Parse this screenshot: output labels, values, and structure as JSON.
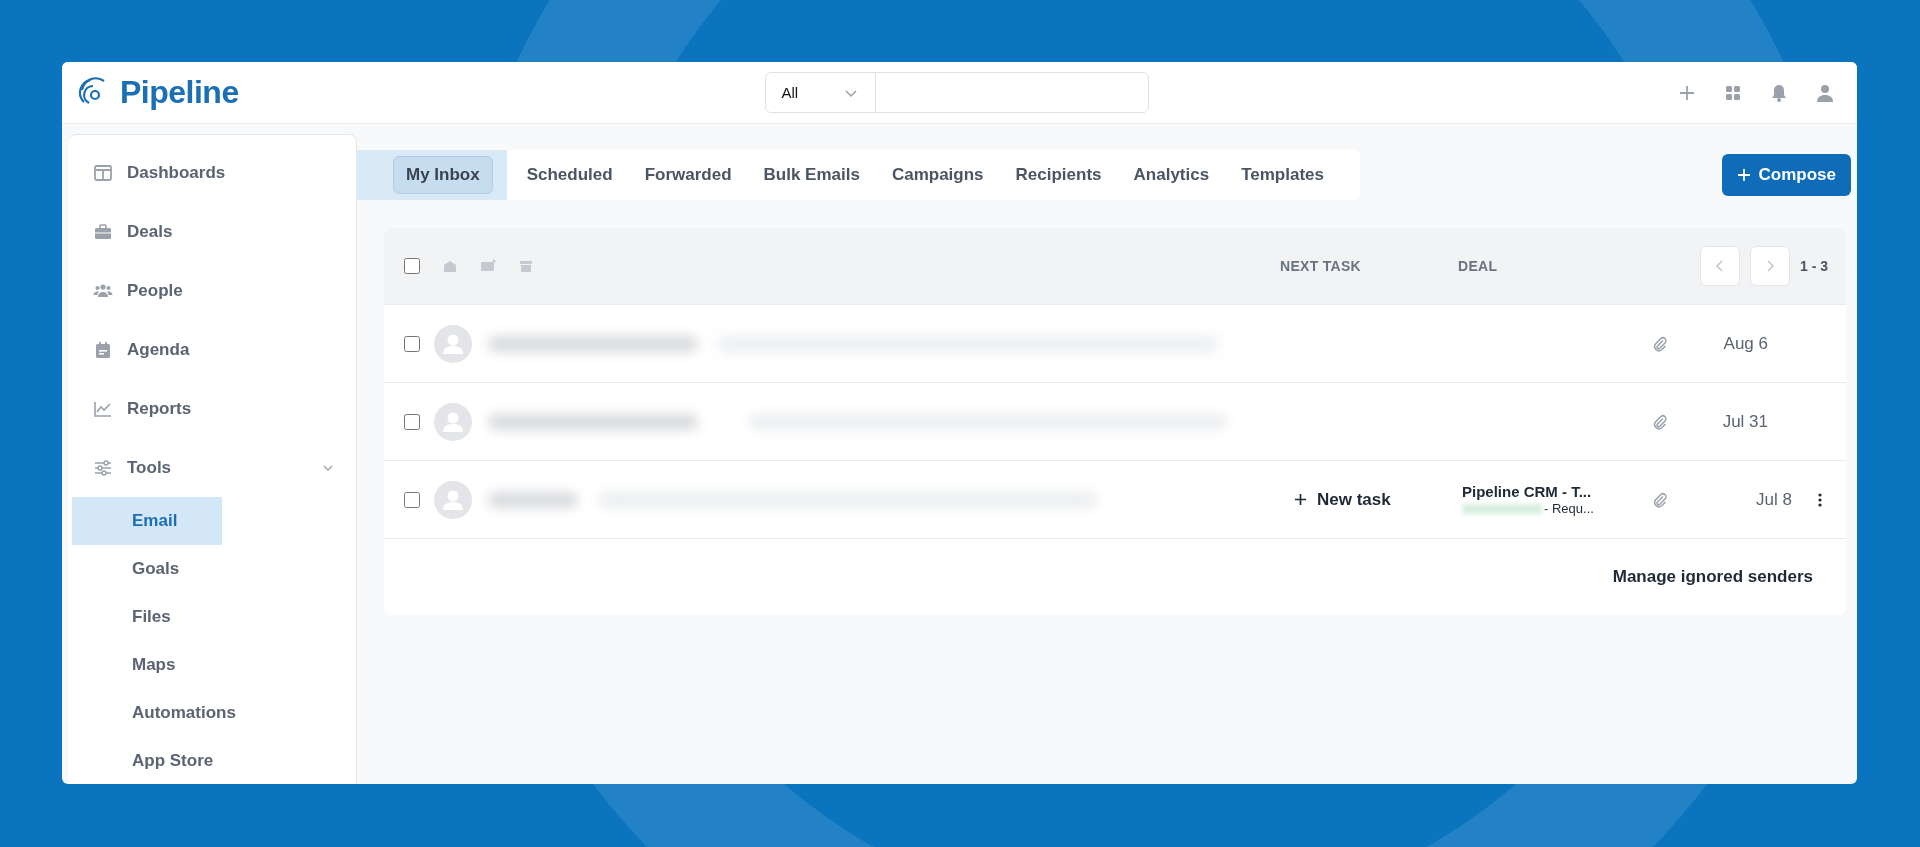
{
  "header": {
    "logo": "Pipeline",
    "search_scope": "All"
  },
  "sidebar": {
    "items": [
      {
        "label": "Dashboards",
        "selected": false
      },
      {
        "label": "Deals",
        "selected": false
      },
      {
        "label": "People",
        "selected": false
      },
      {
        "label": "Agenda",
        "selected": false
      },
      {
        "label": "Reports",
        "selected": false
      },
      {
        "label": "Tools",
        "selected": false,
        "expanded": true,
        "children": [
          {
            "label": "Email",
            "selected": true
          },
          {
            "label": "Goals",
            "selected": false
          },
          {
            "label": "Files",
            "selected": false
          },
          {
            "label": "Maps",
            "selected": false
          },
          {
            "label": "Automations",
            "selected": false
          },
          {
            "label": "App Store",
            "selected": false
          }
        ]
      }
    ]
  },
  "tabs": [
    {
      "label": "My Inbox",
      "selected": true
    },
    {
      "label": "Scheduled",
      "selected": false
    },
    {
      "label": "Forwarded",
      "selected": false
    },
    {
      "label": "Bulk Emails",
      "selected": false
    },
    {
      "label": "Campaigns",
      "selected": false
    },
    {
      "label": "Recipients",
      "selected": false
    },
    {
      "label": "Analytics",
      "selected": false
    },
    {
      "label": "Templates",
      "selected": false
    }
  ],
  "compose": "Compose",
  "table": {
    "select_all_checked": false,
    "columns": [
      "NEXT TASK",
      "DEAL"
    ],
    "range": "1 - 3",
    "rows": [
      {
        "checked": false,
        "date": "Aug 6"
      },
      {
        "checked": false,
        "date": "Jul 31"
      },
      {
        "checked": false,
        "next_task": "New task",
        "deal": "Pipeline CRM - T...",
        "deal_sub": "- Requ...",
        "date": "Jul 8"
      }
    ],
    "footer_link": "Manage ignored senders"
  }
}
